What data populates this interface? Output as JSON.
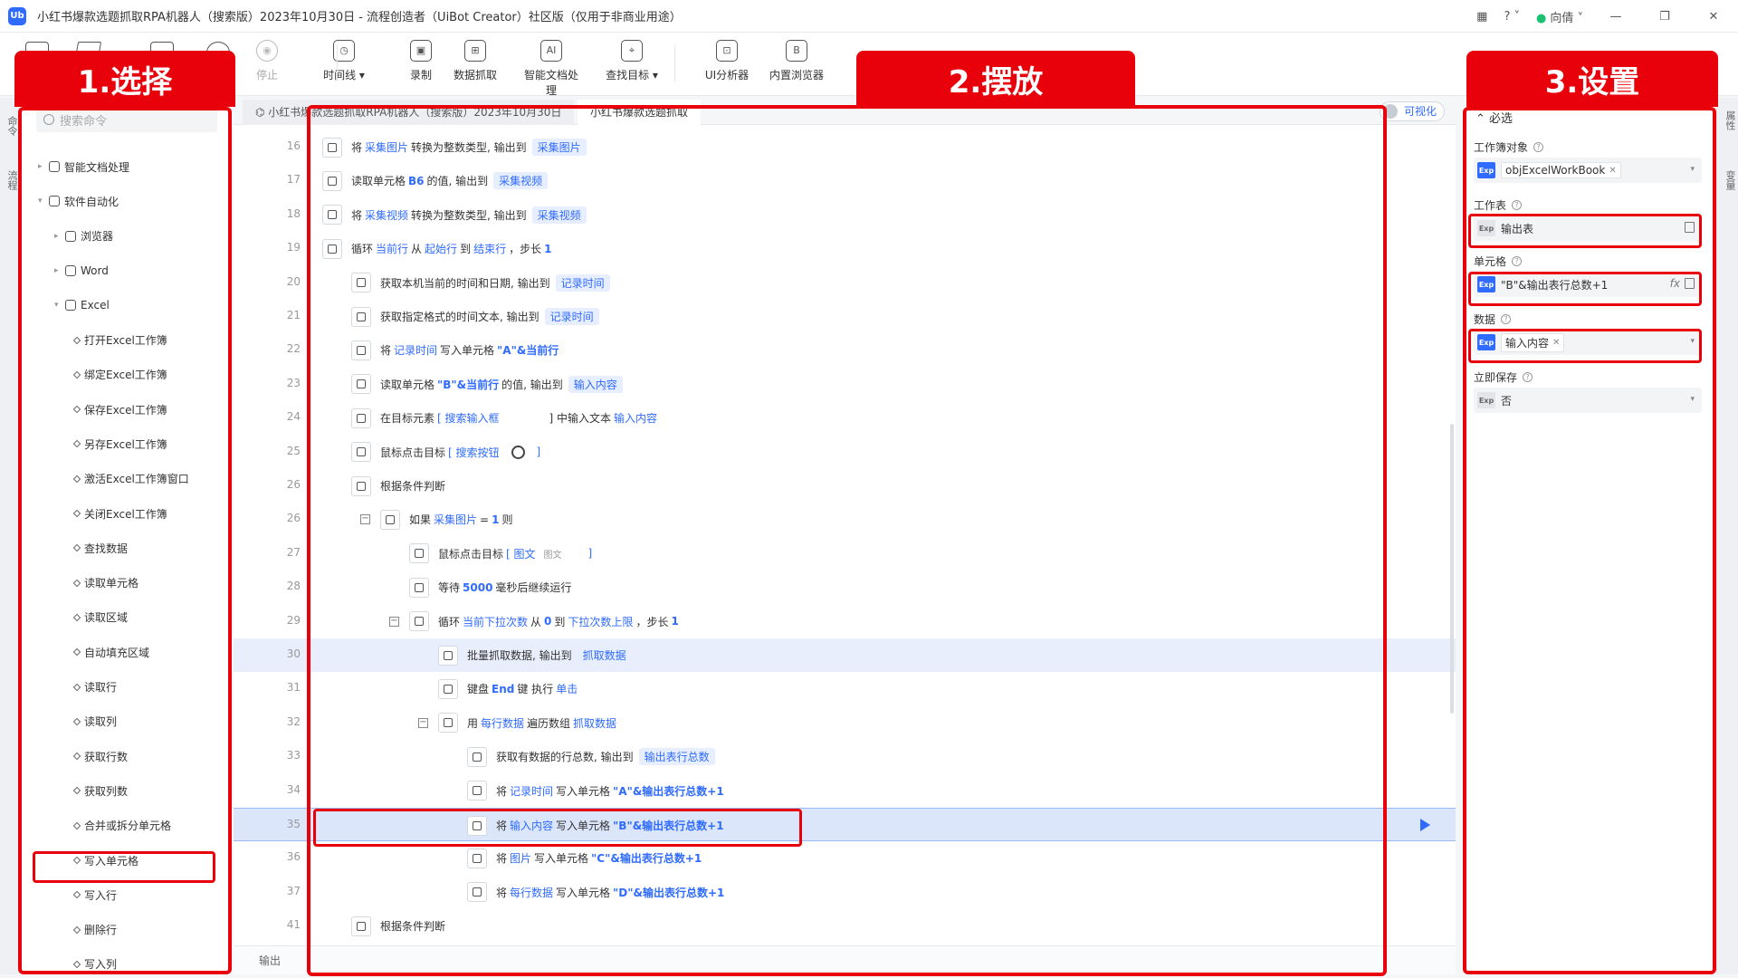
{
  "titlebar": {
    "title": "小红书爆款选题抓取RPA机器人（搜索版）2023年10月30日 - 流程创造者（UiBot Creator）社区版（仅用于非商业用途）",
    "user": "向倩",
    "logo_text": "Ub"
  },
  "toolbar": {
    "buttons": [
      {
        "label": "停止",
        "icon": "stop-icon",
        "disabled": true
      },
      {
        "label": "时间线 ▾",
        "icon": "clock-icon"
      },
      {
        "label": "录制",
        "icon": "record-icon"
      },
      {
        "label": "数据抓取",
        "icon": "data-grab-icon"
      },
      {
        "label": "智能文档处理",
        "icon": "ai-doc-icon"
      },
      {
        "label": "查找目标 ▾",
        "icon": "find-target-icon"
      },
      {
        "label": "UI分析器",
        "icon": "ui-analyzer-icon"
      },
      {
        "label": "内置浏览器",
        "icon": "browser-icon"
      }
    ]
  },
  "left_panel": {
    "search_placeholder": "搜索命令",
    "strip_labels": [
      "命令",
      "流程"
    ],
    "tree": [
      {
        "label": "智能文档处理",
        "level": 0,
        "kind": "folder",
        "expanded": false
      },
      {
        "label": "软件自动化",
        "level": 0,
        "kind": "folder",
        "expanded": true
      },
      {
        "label": "浏览器",
        "level": 1,
        "kind": "folder",
        "expanded": false
      },
      {
        "label": "Word",
        "level": 1,
        "kind": "folder",
        "expanded": false
      },
      {
        "label": "Excel",
        "level": 1,
        "kind": "folder",
        "expanded": true
      },
      {
        "label": "打开Excel工作簿",
        "level": 2,
        "kind": "cmd"
      },
      {
        "label": "绑定Excel工作簿",
        "level": 2,
        "kind": "cmd"
      },
      {
        "label": "保存Excel工作簿",
        "level": 2,
        "kind": "cmd"
      },
      {
        "label": "另存Excel工作簿",
        "level": 2,
        "kind": "cmd"
      },
      {
        "label": "激活Excel工作簿窗口",
        "level": 2,
        "kind": "cmd"
      },
      {
        "label": "关闭Excel工作簿",
        "level": 2,
        "kind": "cmd"
      },
      {
        "label": "查找数据",
        "level": 2,
        "kind": "cmd"
      },
      {
        "label": "读取单元格",
        "level": 2,
        "kind": "cmd"
      },
      {
        "label": "读取区域",
        "level": 2,
        "kind": "cmd"
      },
      {
        "label": "自动填充区域",
        "level": 2,
        "kind": "cmd"
      },
      {
        "label": "读取行",
        "level": 2,
        "kind": "cmd"
      },
      {
        "label": "读取列",
        "level": 2,
        "kind": "cmd"
      },
      {
        "label": "获取行数",
        "level": 2,
        "kind": "cmd"
      },
      {
        "label": "获取列数",
        "level": 2,
        "kind": "cmd"
      },
      {
        "label": "合并或拆分单元格",
        "level": 2,
        "kind": "cmd"
      },
      {
        "label": "写入单元格",
        "level": 2,
        "kind": "cmd"
      },
      {
        "label": "写入行",
        "level": 2,
        "kind": "cmd"
      },
      {
        "label": "删除行",
        "level": 2,
        "kind": "cmd"
      },
      {
        "label": "写入列",
        "level": 2,
        "kind": "cmd"
      }
    ]
  },
  "editor": {
    "tabs": [
      "小红书爆款选题抓取RPA机器人（搜索版）2023年10月30日",
      "小红书爆款选题抓取"
    ],
    "toggle_label": "可视化",
    "output_label": "输出",
    "lines": [
      {
        "num": "16",
        "indent": 0,
        "icon": "convert-icon",
        "parts": [
          [
            "t",
            "将"
          ],
          [
            "v",
            "采集图片"
          ],
          [
            "t",
            "转换为整数类型, 输出到"
          ],
          [
            "c",
            "采集图片"
          ]
        ]
      },
      {
        "num": "17",
        "indent": 0,
        "icon": "excel-icon",
        "parts": [
          [
            "t",
            "读取单元格"
          ],
          [
            "k",
            "B6"
          ],
          [
            "t",
            "的值, 输出到"
          ],
          [
            "c",
            "采集视频"
          ]
        ]
      },
      {
        "num": "18",
        "indent": 0,
        "icon": "convert-icon",
        "parts": [
          [
            "t",
            "将"
          ],
          [
            "v",
            "采集视频"
          ],
          [
            "t",
            "转换为整数类型, 输出到"
          ],
          [
            "c",
            "采集视频"
          ]
        ]
      },
      {
        "num": "19",
        "indent": 0,
        "icon": "loop-icon",
        "fold": false,
        "parts": [
          [
            "t",
            "循环"
          ],
          [
            "v",
            "当前行"
          ],
          [
            "t",
            "从"
          ],
          [
            "v",
            "起始行"
          ],
          [
            "t",
            "到"
          ],
          [
            "v",
            "结束行"
          ],
          [
            "t",
            "，步长"
          ],
          [
            "k",
            "1"
          ]
        ]
      },
      {
        "num": "20",
        "indent": 1,
        "icon": "calendar-icon",
        "parts": [
          [
            "t",
            "获取本机当前的时间和日期, 输出到"
          ],
          [
            "c",
            "记录时间"
          ]
        ]
      },
      {
        "num": "21",
        "indent": 1,
        "icon": "calendar-icon",
        "parts": [
          [
            "t",
            "获取指定格式的时间文本, 输出到"
          ],
          [
            "c",
            "记录时间"
          ]
        ]
      },
      {
        "num": "22",
        "indent": 1,
        "icon": "excel-icon",
        "parts": [
          [
            "t",
            "将"
          ],
          [
            "v",
            "记录时间"
          ],
          [
            "t",
            "写入单元格"
          ],
          [
            "k",
            "\"A\"&当前行"
          ]
        ]
      },
      {
        "num": "23",
        "indent": 1,
        "icon": "excel-icon",
        "parts": [
          [
            "t",
            "读取单元格"
          ],
          [
            "k",
            "\"B\"&当前行"
          ],
          [
            "t",
            "的值, 输出到"
          ],
          [
            "c",
            "输入内容"
          ]
        ]
      },
      {
        "num": "24",
        "indent": 1,
        "icon": "keyboard-icon",
        "parts": [
          [
            "t",
            "在目标元素"
          ],
          [
            "v",
            "[ 搜索输入框"
          ],
          [
            "g",
            ""
          ],
          [
            "t",
            "] 中输入文本"
          ],
          [
            "v",
            "输入内容"
          ]
        ]
      },
      {
        "num": "25",
        "indent": 1,
        "icon": "mouse-icon",
        "parts": [
          [
            "t",
            "鼠标点击目标"
          ],
          [
            "v",
            "[ 搜索按钮"
          ],
          [
            "s",
            ""
          ],
          [
            "v",
            "]"
          ]
        ]
      },
      {
        "num": "26",
        "indent": 1,
        "icon": "condition-icon",
        "parts": [
          [
            "t",
            "根据条件判断"
          ]
        ]
      },
      {
        "num": "26",
        "indent": 2,
        "icon": "condition-icon",
        "fold": true,
        "parts": [
          [
            "t",
            "如果"
          ],
          [
            "v",
            "采集图片"
          ],
          [
            "t",
            "="
          ],
          [
            "k",
            "1"
          ],
          [
            "t",
            "则"
          ]
        ]
      },
      {
        "num": "27",
        "indent": 3,
        "icon": "mouse-icon",
        "parts": [
          [
            "t",
            "鼠标点击目标"
          ],
          [
            "v",
            "[ 图文"
          ],
          [
            "g",
            "图文"
          ],
          [
            "v",
            "]"
          ]
        ]
      },
      {
        "num": "28",
        "indent": 3,
        "icon": "wait-icon",
        "parts": [
          [
            "t",
            "等待"
          ],
          [
            "k",
            "5000"
          ],
          [
            "t",
            "毫秒后继续运行"
          ]
        ]
      },
      {
        "num": "29",
        "indent": 3,
        "icon": "loop-icon",
        "fold": true,
        "parts": [
          [
            "t",
            "循环"
          ],
          [
            "v",
            "当前下拉次数"
          ],
          [
            "t",
            "从"
          ],
          [
            "k",
            "0"
          ],
          [
            "t",
            "到"
          ],
          [
            "v",
            "下拉次数上限"
          ],
          [
            "t",
            "，步长"
          ],
          [
            "k",
            "1"
          ]
        ]
      },
      {
        "num": "30",
        "indent": 4,
        "icon": "grab-icon",
        "hl": true,
        "parts": [
          [
            "t",
            "批量抓取数据, 输出到"
          ],
          [
            "c",
            "抓取数据"
          ]
        ]
      },
      {
        "num": "31",
        "indent": 4,
        "icon": "keyboard-icon",
        "parts": [
          [
            "t",
            "键盘"
          ],
          [
            "k",
            "End"
          ],
          [
            "t",
            "键 执行"
          ],
          [
            "v",
            "单击"
          ]
        ]
      },
      {
        "num": "32",
        "indent": 4,
        "icon": "loop-icon",
        "fold": true,
        "parts": [
          [
            "t",
            "用"
          ],
          [
            "v",
            "每行数据"
          ],
          [
            "t",
            "遍历数组"
          ],
          [
            "v",
            "抓取数据"
          ]
        ]
      },
      {
        "num": "33",
        "indent": 5,
        "icon": "excel-icon",
        "parts": [
          [
            "t",
            "获取有数据的行总数, 输出到"
          ],
          [
            "c",
            "输出表行总数"
          ]
        ]
      },
      {
        "num": "34",
        "indent": 5,
        "icon": "excel-icon",
        "parts": [
          [
            "t",
            "将"
          ],
          [
            "v",
            "记录时间"
          ],
          [
            "t",
            "写入单元格"
          ],
          [
            "k",
            "\"A\"&输出表行总数+1"
          ]
        ]
      },
      {
        "num": "35",
        "indent": 5,
        "icon": "excel-icon",
        "sel": true,
        "parts": [
          [
            "t",
            "将"
          ],
          [
            "v",
            "输入内容"
          ],
          [
            "t",
            "写入单元格"
          ],
          [
            "k",
            "\"B\"&输出表行总数+1"
          ]
        ]
      },
      {
        "num": "36",
        "indent": 5,
        "icon": "excel-icon",
        "parts": [
          [
            "t",
            "将"
          ],
          [
            "v",
            "图片"
          ],
          [
            "t",
            "写入单元格"
          ],
          [
            "k",
            "\"C\"&输出表行总数+1"
          ]
        ]
      },
      {
        "num": "37",
        "indent": 5,
        "icon": "excel-icon",
        "parts": [
          [
            "t",
            "将"
          ],
          [
            "v",
            "每行数据"
          ],
          [
            "t",
            "写入单元格"
          ],
          [
            "k",
            "\"D\"&输出表行总数+1"
          ]
        ]
      },
      {
        "num": "41",
        "indent": 1,
        "icon": "condition-icon",
        "parts": [
          [
            "t",
            "根据条件判断"
          ]
        ]
      }
    ]
  },
  "props": {
    "section": "⌃ 必选",
    "strip_labels": [
      "属性",
      "变量"
    ],
    "fields": [
      {
        "label": "工作簿对象",
        "value": "objExcelWorkBook",
        "style": "tag",
        "exp": "Exp",
        "active": true
      },
      {
        "label": "工作表",
        "value": "输出表",
        "style": "text",
        "exp": "Exp",
        "active": false,
        "edit": true
      },
      {
        "label": "单元格",
        "value": "\"B\"&输出表行总数+1",
        "style": "text",
        "exp": "Exp",
        "active": true,
        "fx": "fx",
        "edit": true
      },
      {
        "label": "数据",
        "value": "输入内容",
        "style": "tag",
        "exp": "Exp",
        "active": true
      },
      {
        "label": "立即保存",
        "value": "否",
        "style": "select",
        "exp": "Exp",
        "active": false
      }
    ]
  },
  "annotations": {
    "step1": "1.选择",
    "step2": "2.摆放",
    "step3": "3.设置",
    "color": "#e8000b"
  }
}
